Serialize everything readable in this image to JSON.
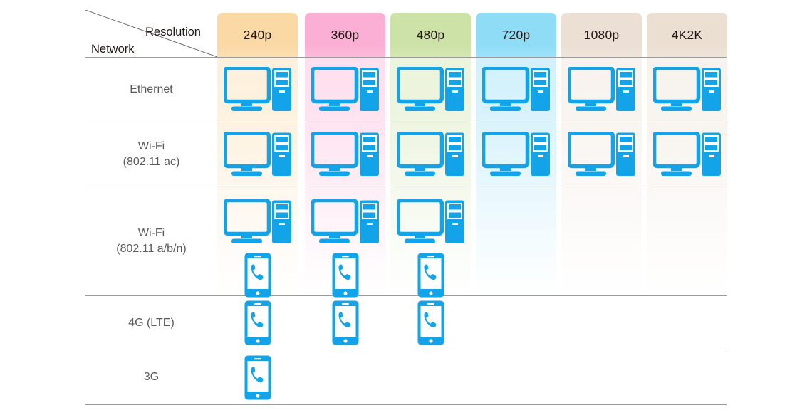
{
  "header": {
    "corner": {
      "row_axis_label": "Network",
      "col_axis_label": "Resolution"
    },
    "columns": [
      {
        "label": "240p",
        "tint": "#fbd9a5"
      },
      {
        "label": "360p",
        "tint": "#fbafd4"
      },
      {
        "label": "480p",
        "tint": "#cde2a7"
      },
      {
        "label": "720p",
        "tint": "#8fdcf7"
      },
      {
        "label": "1080p",
        "tint": "#ece0d4"
      },
      {
        "label": "4K2K",
        "tint": "#eadfd1"
      }
    ]
  },
  "rows": [
    {
      "label": "Ethernet",
      "label_line2": ""
    },
    {
      "label": "Wi-Fi",
      "label_line2": "(802.11 ac)"
    },
    {
      "label": "Wi-Fi",
      "label_line2": "(802.11 a/b/n)"
    },
    {
      "label": "4G (LTE)",
      "label_line2": ""
    },
    {
      "label": "3G",
      "label_line2": ""
    }
  ],
  "matrix": [
    {
      "row": "Ethernet",
      "cells": [
        "pc",
        "pc",
        "pc",
        "pc",
        "pc",
        "pc"
      ]
    },
    {
      "row": "Wi-Fi (802.11 ac)",
      "cells": [
        "pc",
        "pc",
        "pc",
        "pc",
        "pc",
        "pc"
      ]
    },
    {
      "row": "Wi-Fi (802.11 a/b/n)",
      "cells": [
        "pc+phone",
        "pc+phone",
        "pc+phone",
        "",
        "",
        ""
      ]
    },
    {
      "row": "4G (LTE)",
      "cells": [
        "phone",
        "phone",
        "phone",
        "",
        "",
        ""
      ]
    },
    {
      "row": "3G",
      "cells": [
        "phone",
        "",
        "",
        "",
        "",
        ""
      ]
    }
  ],
  "icons": {
    "pc": "desktop-computer-icon",
    "phone": "mobile-phone-icon"
  },
  "colors": {
    "device_blue": "#12a3e8",
    "grid_line": "#9a9a9a",
    "row_label_text": "#5b5b5b",
    "header_text": "#231815",
    "background": "#ffffff"
  }
}
